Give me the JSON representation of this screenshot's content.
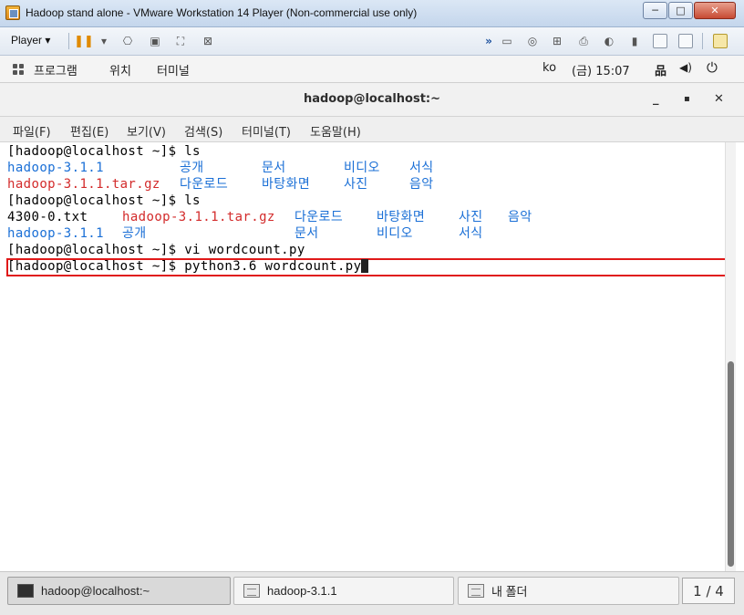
{
  "window": {
    "title": "Hadoop stand alone - VMware Workstation 14 Player (Non-commercial use only)",
    "min_glyph": "─",
    "max_glyph": "□",
    "close_glyph": "✕"
  },
  "vm_toolbar": {
    "player_label": "Player ▾",
    "pause_glyph": "❚❚",
    "dropdown_glyph": "▾",
    "arrow_glyph": "»",
    "icons": [
      "send-ctrl-alt-del-icon",
      "snapshot-icon",
      "fullscreen-icon",
      "unity-icon",
      "hard-disk-icon",
      "cd-icon",
      "network-icon",
      "printer-icon",
      "sound-icon",
      "usb-icon",
      "display-icon",
      "display-icon-2",
      "notes-icon"
    ]
  },
  "gnome": {
    "apps": "프로그램",
    "places": "위치",
    "terminal": "터미널",
    "lang": "ko",
    "clock": "(금) 15:07",
    "network_glyph": "品",
    "volume_glyph": "◀)",
    "power_glyph": "⏻"
  },
  "terminal": {
    "title": "hadoop@localhost:~",
    "min_glyph": "_",
    "max_glyph": "▪",
    "close_glyph": "✕",
    "menu": [
      "파일(F)",
      "편집(E)",
      "보기(V)",
      "검색(S)",
      "터미널(T)",
      "도움말(H)"
    ],
    "lines": [
      {
        "prompt": "[hadoop@localhost ~]$ ls"
      },
      {
        "segments": [
          {
            "text": "hadoop-3.1.1",
            "color": "blue",
            "col": 0
          },
          {
            "text": "공개",
            "color": "blue",
            "col": 21
          },
          {
            "text": "문서",
            "color": "blue",
            "col": 31
          },
          {
            "text": "비디오",
            "color": "blue",
            "col": 41
          },
          {
            "text": "서식",
            "color": "blue",
            "col": 49
          }
        ]
      },
      {
        "segments": [
          {
            "text": "hadoop-3.1.1.tar.gz",
            "color": "red",
            "col": 0
          },
          {
            "text": "다운로드",
            "color": "blue",
            "col": 21
          },
          {
            "text": "바탕화면",
            "color": "blue",
            "col": 31
          },
          {
            "text": "사진",
            "color": "blue",
            "col": 41
          },
          {
            "text": "음악",
            "color": "blue",
            "col": 49
          }
        ]
      },
      {
        "prompt": "[hadoop@localhost ~]$ ls"
      },
      {
        "segments": [
          {
            "text": "4300-0.txt",
            "color": "black",
            "col": 0
          },
          {
            "text": "hadoop-3.1.1.tar.gz",
            "color": "red",
            "col": 14
          },
          {
            "text": "다운로드",
            "color": "blue",
            "col": 35
          },
          {
            "text": "바탕화면",
            "color": "blue",
            "col": 45
          },
          {
            "text": "사진",
            "color": "blue",
            "col": 55
          },
          {
            "text": "음악",
            "color": "blue",
            "col": 61
          }
        ]
      },
      {
        "segments": [
          {
            "text": "hadoop-3.1.1",
            "color": "blue",
            "col": 0
          },
          {
            "text": "공개",
            "color": "blue",
            "col": 14
          },
          {
            "text": "문서",
            "color": "blue",
            "col": 35
          },
          {
            "text": "비디오",
            "color": "blue",
            "col": 45
          },
          {
            "text": "서식",
            "color": "blue",
            "col": 55
          }
        ]
      },
      {
        "prompt": "[hadoop@localhost ~]$ vi wordcount.py"
      },
      {
        "prompt": "[hadoop@localhost ~]$ python3.6 wordcount.py",
        "cursor": true
      }
    ]
  },
  "taskbar": {
    "items": [
      {
        "label": "hadoop@localhost:~",
        "active": true
      },
      {
        "label": "hadoop-3.1.1",
        "active": false
      },
      {
        "label": "내 폴더",
        "active": false
      }
    ],
    "pager": "1 / 4"
  },
  "colors": {
    "blue": "#1a6fd6",
    "red": "#d32b2b",
    "highlight": "#e01919"
  }
}
